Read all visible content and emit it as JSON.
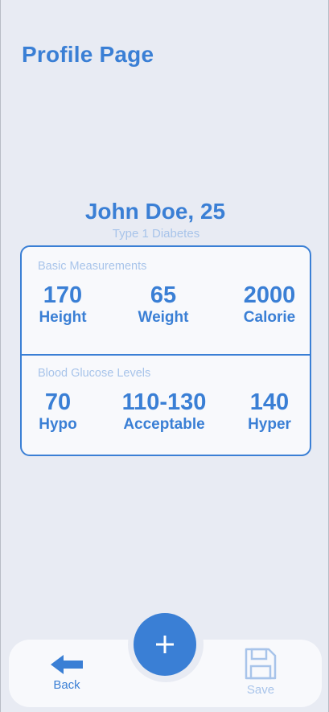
{
  "header": {
    "title": "Profile Page"
  },
  "profile": {
    "name": "John Doe, 25",
    "condition": "Type 1 Diabetes"
  },
  "basic_measurements": {
    "label": "Basic Measurements",
    "items": [
      {
        "value": "170",
        "label": "Height"
      },
      {
        "value": "65",
        "label": "Weight"
      },
      {
        "value": "2000",
        "label": "Calorie"
      }
    ]
  },
  "glucose_levels": {
    "label": "Blood Glucose Levels",
    "items": [
      {
        "value": "70",
        "label": "Hypo"
      },
      {
        "value": "110-130",
        "label": "Acceptable"
      },
      {
        "value": "140",
        "label": "Hyper"
      }
    ]
  },
  "nav": {
    "add_icon": "plus-icon",
    "back_label": "Back",
    "back_icon": "arrow-left-icon",
    "save_label": "Save",
    "save_icon": "floppy-disk-icon"
  },
  "colors": {
    "accent": "#3a7fd5",
    "muted": "#a8c4ea",
    "background": "#e8ebf3",
    "card": "#f8f9fc"
  }
}
